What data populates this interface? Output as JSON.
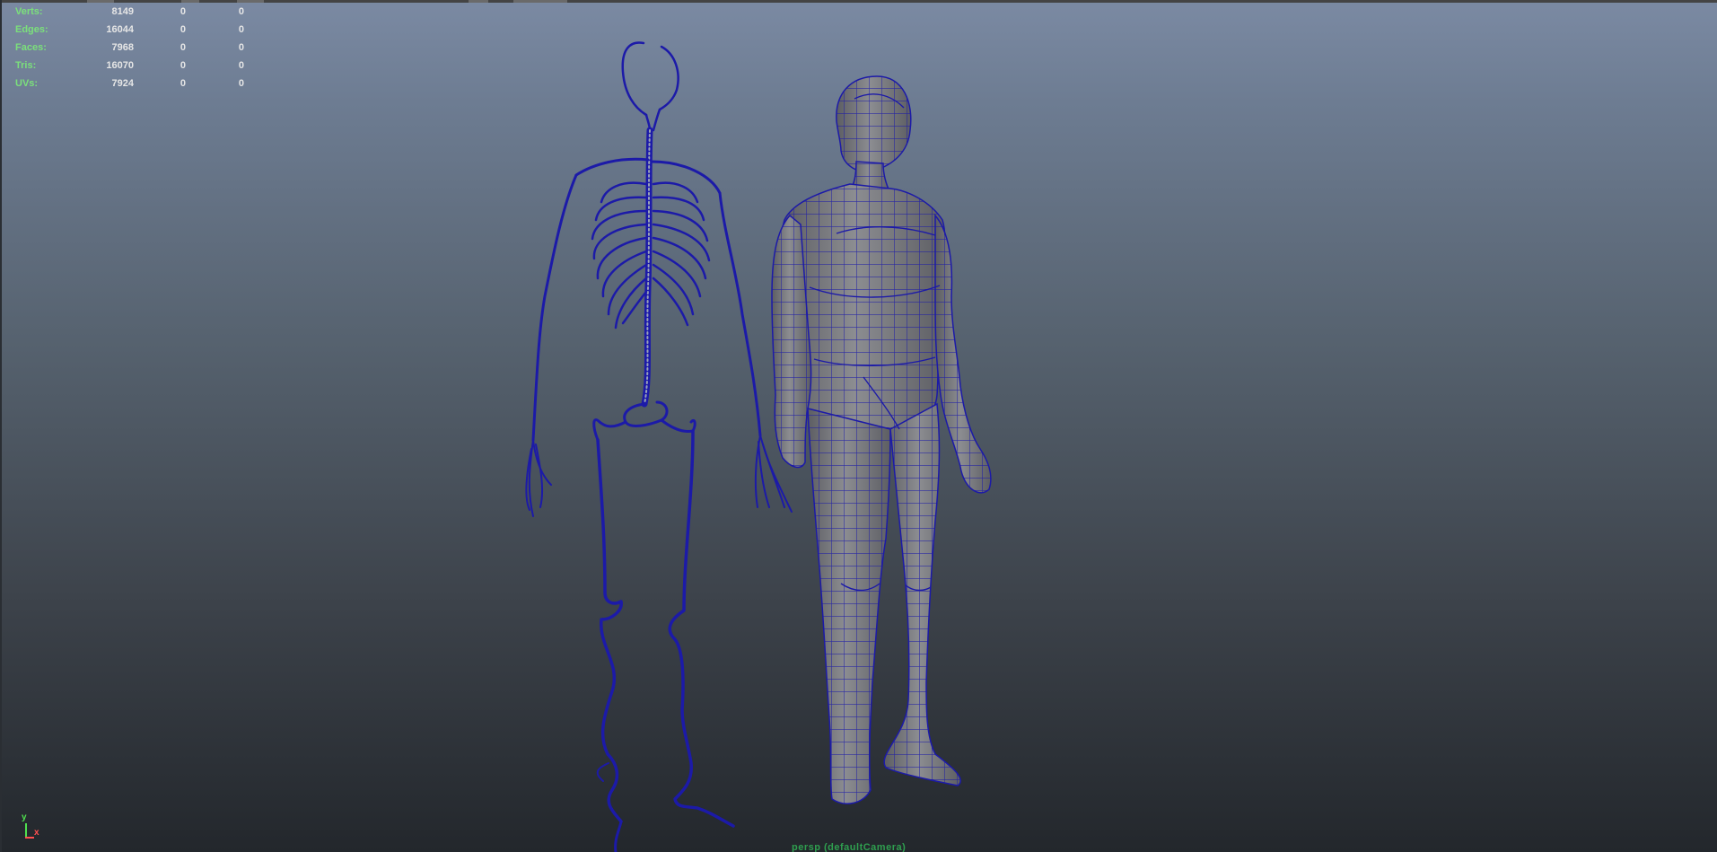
{
  "hud": {
    "rows": [
      {
        "label": "Verts:",
        "c1": "8149",
        "c2": "0",
        "c3": "0"
      },
      {
        "label": "Edges:",
        "c1": "16044",
        "c2": "0",
        "c3": "0"
      },
      {
        "label": "Faces:",
        "c1": "7968",
        "c2": "0",
        "c3": "0"
      },
      {
        "label": "Tris:",
        "c1": "16070",
        "c2": "0",
        "c3": "0"
      },
      {
        "label": "UVs:",
        "c1": "7924",
        "c2": "0",
        "c3": "0"
      }
    ]
  },
  "axis": {
    "y": "y",
    "x": "x"
  },
  "camera_label": "persp (defaultCamera)",
  "colors": {
    "wire": "#1c1aa8",
    "mesh_fill": "#7b7c80",
    "hud_label": "#7be07b",
    "hud_value": "#e6e6e6"
  }
}
